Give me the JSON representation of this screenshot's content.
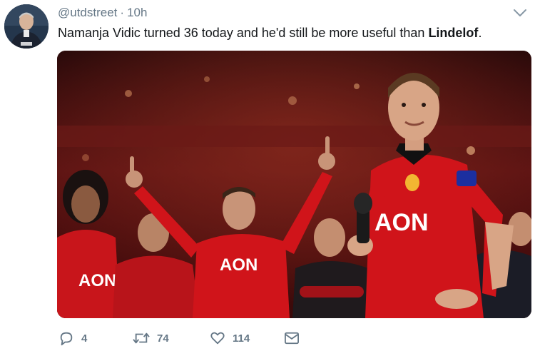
{
  "tweet": {
    "handle": "@utdstreet",
    "separator": "·",
    "time": "10h",
    "text_before": "Namanja Vidic turned 36 today and he'd still be more useful than ",
    "text_bold": "Lindelof",
    "text_after": ".",
    "media": {
      "jersey_sponsor": "AON"
    }
  },
  "actions": {
    "reply_count": "4",
    "retweet_count": "74",
    "like_count": "114"
  },
  "icons": {
    "reply": "reply-icon",
    "retweet": "retweet-icon",
    "like": "heart-icon",
    "message": "envelope-icon",
    "menu": "chevron-down-icon"
  },
  "colors": {
    "secondary_text": "#657786",
    "primary_text": "#14171a",
    "jersey_red": "#d0141a"
  }
}
